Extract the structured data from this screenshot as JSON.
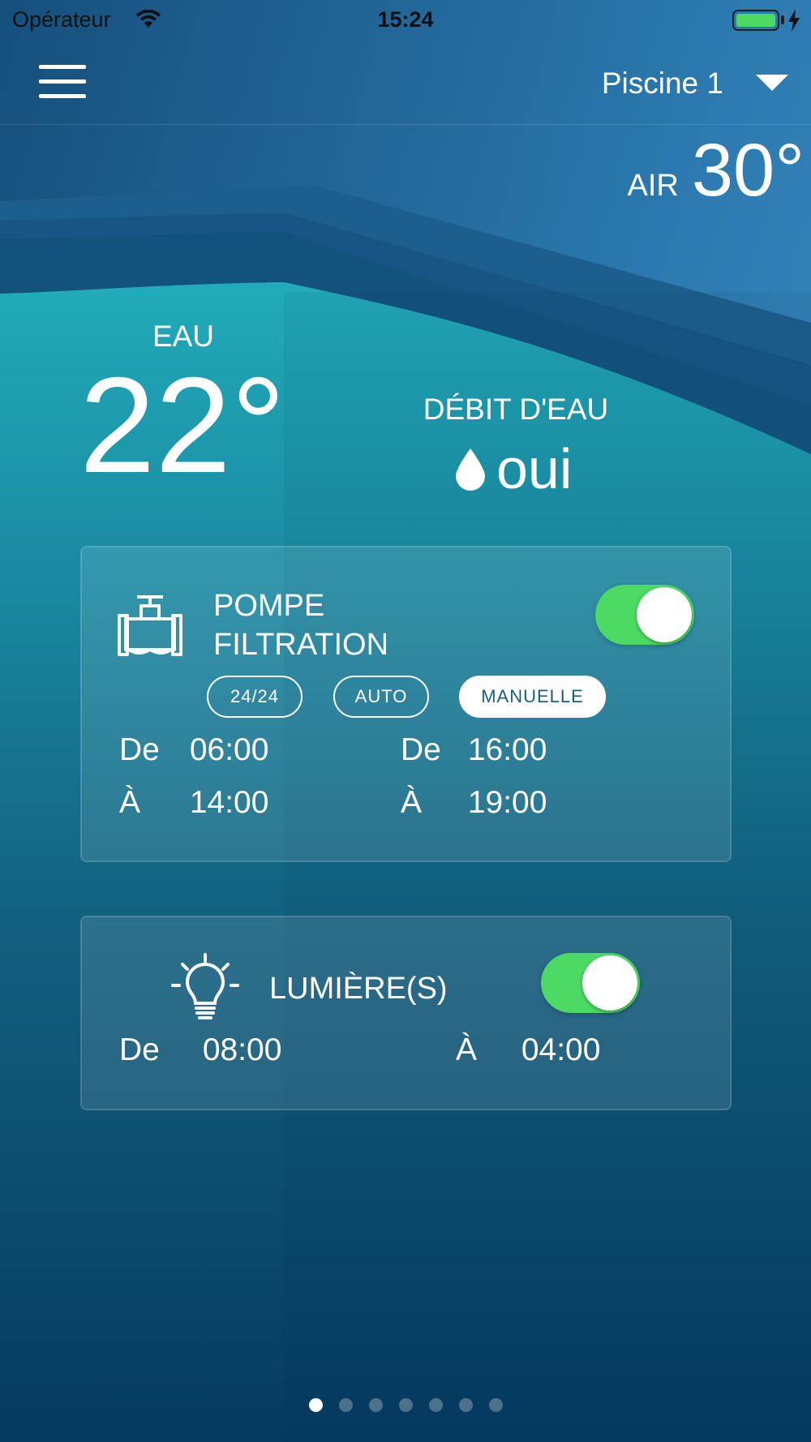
{
  "status_bar": {
    "carrier": "Opérateur",
    "time": "15:24",
    "battery_level": 1.0,
    "charging": true
  },
  "header": {
    "menu_icon": "hamburger-menu-icon",
    "pool_selector": "Piscine 1",
    "dropdown_icon": "caret-down-icon"
  },
  "air": {
    "label": "AIR",
    "value": "30°"
  },
  "water": {
    "label": "EAU",
    "value": "22°"
  },
  "flow": {
    "label": "DÉBIT D'EAU",
    "icon": "water-drop-icon",
    "value": "oui"
  },
  "pump": {
    "icon": "valve-icon",
    "title_line1": "POMPE",
    "title_line2": "FILTRATION",
    "enabled": true,
    "modes": [
      "24/24",
      "AUTO",
      "MANUELLE"
    ],
    "active_mode": "MANUELLE",
    "schedule": [
      {
        "from_label": "De",
        "from": "06:00",
        "to_label": "À",
        "to": "14:00"
      },
      {
        "from_label": "De",
        "from": "16:00",
        "to_label": "À",
        "to": "19:00"
      }
    ]
  },
  "light": {
    "icon": "light-bulb-icon",
    "title": "LUMIÈRE(S)",
    "enabled": true,
    "from_label": "De",
    "from": "08:00",
    "to_label": "À",
    "to": "04:00"
  },
  "pager": {
    "count": 7,
    "active": 0
  },
  "colors": {
    "toggle_on": "#4cd964",
    "active_mode_text": "#1b5f7d",
    "water_top": "#1ea8b6",
    "sky_top": "#2c7fb0",
    "deep_bottom": "#073d62"
  }
}
